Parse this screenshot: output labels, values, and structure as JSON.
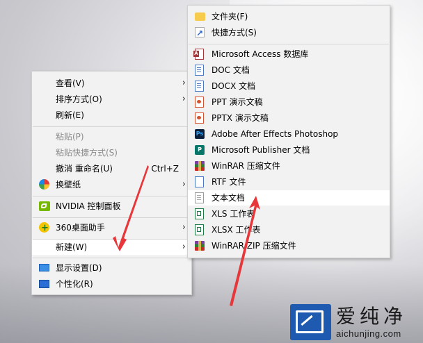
{
  "context_menu": {
    "items": [
      {
        "label": "查看(V)",
        "has_submenu": true
      },
      {
        "label": "排序方式(O)",
        "has_submenu": true
      },
      {
        "label": "刷新(E)"
      },
      {
        "label": "粘贴(P)",
        "disabled": true
      },
      {
        "label": "粘贴快捷方式(S)",
        "disabled": true
      },
      {
        "label": "撤消 重命名(U)",
        "shortcut": "Ctrl+Z"
      },
      {
        "label": "换壁纸",
        "has_submenu": true
      },
      {
        "label": "NVIDIA 控制面板"
      },
      {
        "label": "360桌面助手",
        "has_submenu": true
      },
      {
        "label": "新建(W)",
        "has_submenu": true
      },
      {
        "label": "显示设置(D)"
      },
      {
        "label": "个性化(R)"
      }
    ],
    "arrow_glyph": "›"
  },
  "new_submenu": {
    "items": [
      {
        "label": "文件夹(F)"
      },
      {
        "label": "快捷方式(S)"
      },
      {
        "label": "Microsoft Access 数据库"
      },
      {
        "label": "DOC 文档"
      },
      {
        "label": "DOCX 文档"
      },
      {
        "label": "PPT 演示文稿"
      },
      {
        "label": "PPTX 演示文稿"
      },
      {
        "label": "Adobe After Effects Photoshop"
      },
      {
        "label": "Microsoft Publisher 文档"
      },
      {
        "label": "WinRAR 压缩文件"
      },
      {
        "label": "RTF 文件"
      },
      {
        "label": "文本文档",
        "highlighted": true
      },
      {
        "label": "XLS 工作表"
      },
      {
        "label": "XLSX 工作表"
      },
      {
        "label": "WinRAR ZIP 压缩文件"
      }
    ]
  },
  "icons": {
    "ps": "Ps",
    "pub": "P"
  },
  "watermark": {
    "name": "爱纯净",
    "url": "aichunjing.com"
  },
  "colors": {
    "arrow": "#e8373a",
    "menu_bg": "#f2f2f2",
    "highlight_bg": "#ffffff",
    "logo_blue": "#1e5bb0"
  }
}
